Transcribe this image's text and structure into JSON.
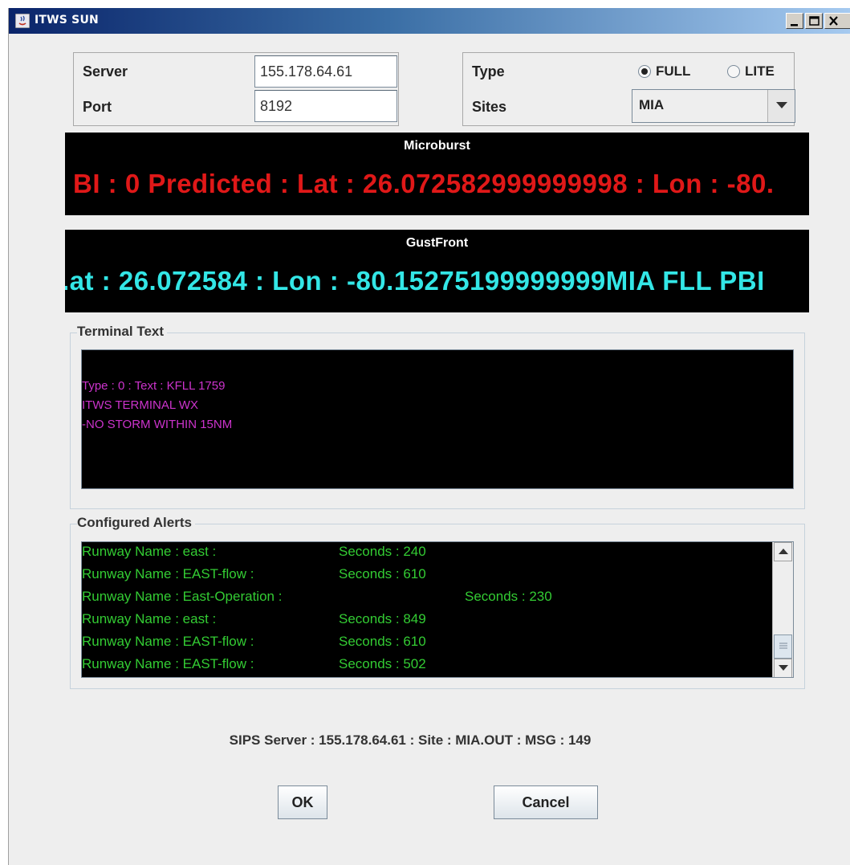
{
  "window": {
    "title": "ITWS SUN"
  },
  "connection": {
    "server_label": "Server",
    "server_value": "155.178.64.61",
    "port_label": "Port",
    "port_value": "8192"
  },
  "options": {
    "type_label": "Type",
    "type_options": [
      {
        "label": "FULL",
        "selected": true
      },
      {
        "label": "LITE",
        "selected": false
      }
    ],
    "sites_label": "Sites",
    "sites_value": "MIA"
  },
  "microburst": {
    "title": "Microburst",
    "text": "BI : 0 Predicted  : Lat : 26.072582999999998 : Lon : -80.",
    "color": "#e01818"
  },
  "gustfront": {
    "title": "GustFront",
    "text": ".at : 26.072584 : Lon : -80.15275199999999MIA FLL PBI",
    "color": "#33e6e6"
  },
  "terminal": {
    "title": "Terminal Text",
    "lines": [
      "Type : 0 : Text : KFLL 1759",
      "ITWS TERMINAL WX",
      "-NO STORM WITHIN 15NM"
    ],
    "color": "#cc33cc"
  },
  "alerts": {
    "title": "Configured Alerts",
    "rows": [
      {
        "runway": "Runway Name : east :",
        "seconds": "Seconds : 240",
        "wide": false
      },
      {
        "runway": "Runway Name : EAST-flow :",
        "seconds": "Seconds : 610",
        "wide": false
      },
      {
        "runway": "Runway Name : East-Operation :",
        "seconds": "Seconds : 230",
        "wide": true
      },
      {
        "runway": "Runway Name : east :",
        "seconds": "Seconds : 849",
        "wide": false
      },
      {
        "runway": "Runway Name : EAST-flow :",
        "seconds": "Seconds : 610",
        "wide": false
      },
      {
        "runway": "Runway Name : EAST-flow :",
        "seconds": "Seconds : 502",
        "wide": false
      }
    ],
    "color": "#33cc33"
  },
  "status": {
    "text": "SIPS Server : 155.178.64.61 : Site : MIA.OUT : MSG : 149"
  },
  "buttons": {
    "ok_label": "OK",
    "cancel_label": "Cancel"
  }
}
